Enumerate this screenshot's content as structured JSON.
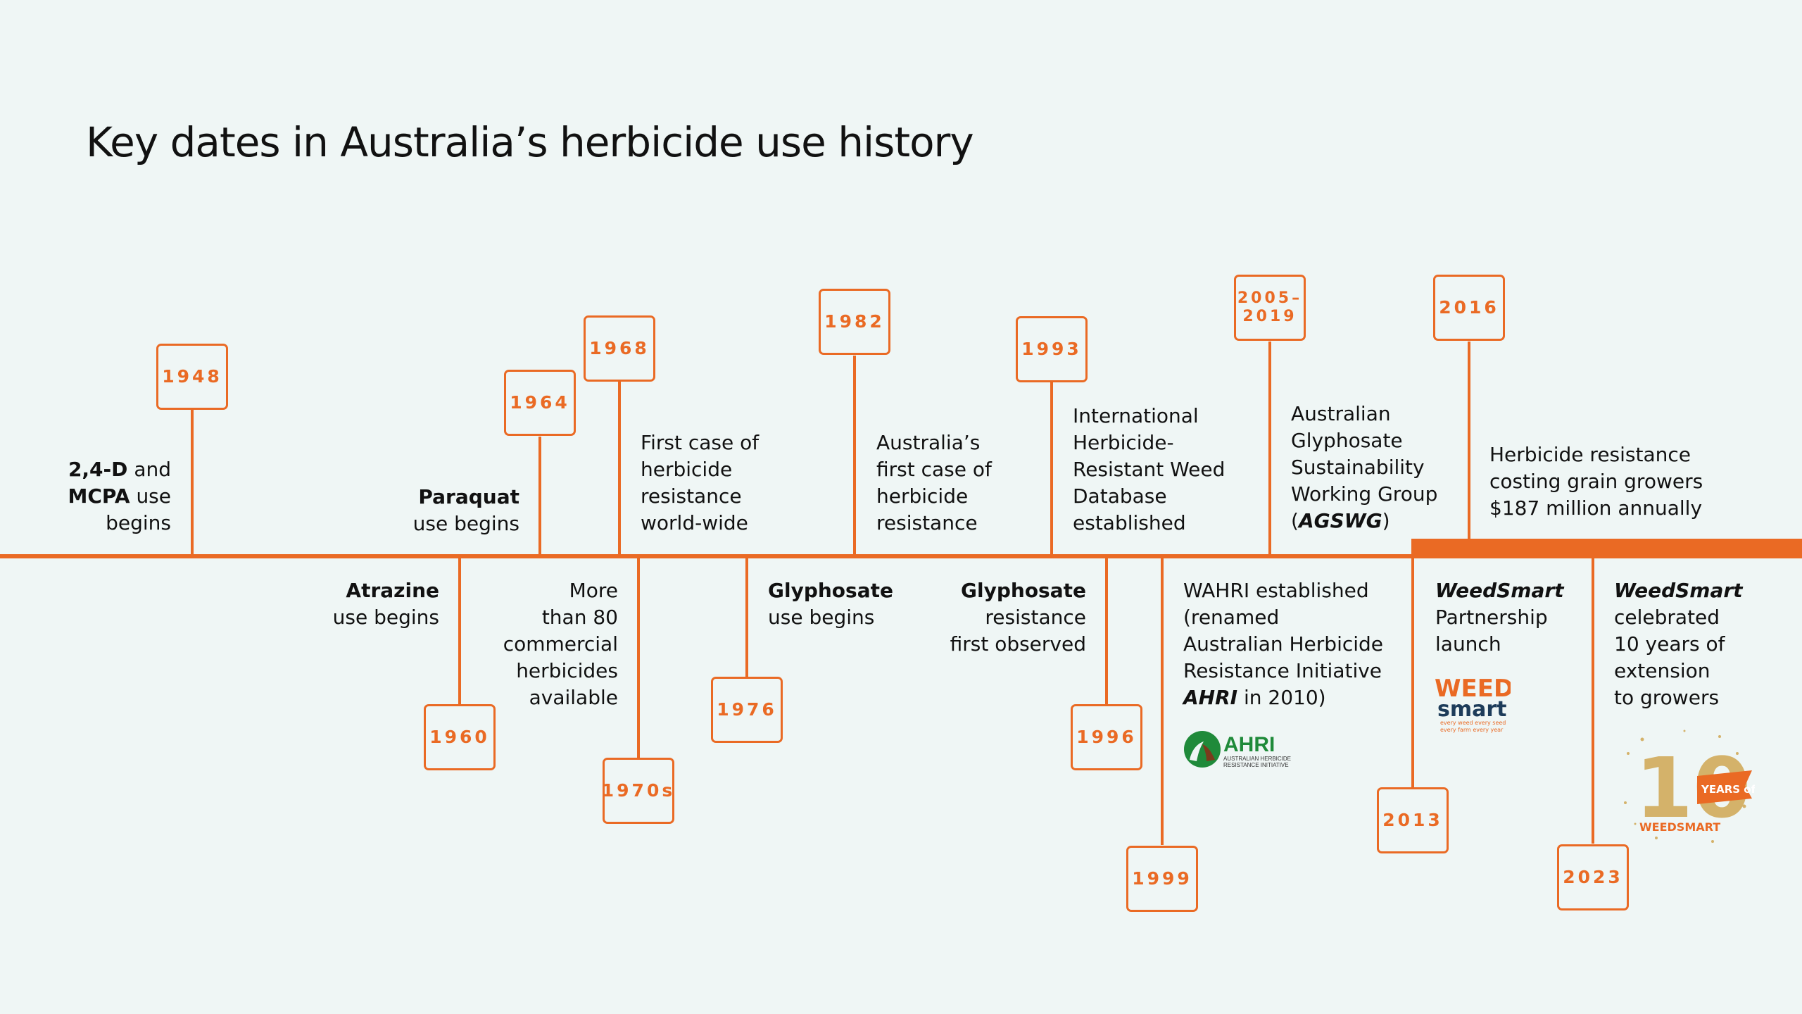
{
  "title": "Key dates in Australia’s herbicide use history",
  "colors": {
    "accent": "#ea6a24",
    "background": "#eff6f5",
    "text": "#111111",
    "ahri_green": "#1f8a3a",
    "weedsmart_navy": "#1d3c5a",
    "gold": "#d4b26a"
  },
  "events": [
    {
      "id": "1948",
      "year": "1948",
      "label": {
        "bold": "2,4-D",
        "text": "and",
        "bold2": "MCPA",
        "text2": "use",
        "line3": "begins"
      }
    },
    {
      "id": "1960",
      "year": "1960",
      "label": {
        "bold": "Atrazine",
        "text": "use begins"
      }
    },
    {
      "id": "1964",
      "year": "1964",
      "label": {
        "bold": "Paraquat",
        "text": "use begins"
      }
    },
    {
      "id": "1968",
      "year": "1968",
      "label": {
        "lines": [
          "First case of",
          "herbicide",
          "resistance",
          "world-wide"
        ]
      }
    },
    {
      "id": "1970s",
      "year": "1970s",
      "label": {
        "lines": [
          "More",
          "than 80",
          "commercial",
          "herbicides",
          "available"
        ]
      }
    },
    {
      "id": "1976",
      "year": "1976",
      "label": {
        "bold": "Glyphosate",
        "text": "use begins"
      }
    },
    {
      "id": "1982",
      "year": "1982",
      "label": {
        "lines": [
          "Australia’s",
          "first case of",
          "herbicide",
          "resistance"
        ]
      }
    },
    {
      "id": "1993",
      "year": "1993",
      "label": {
        "lines": [
          "International",
          "Herbicide-",
          "Resistant Weed",
          "Database",
          "established"
        ]
      }
    },
    {
      "id": "1996",
      "year": "1996",
      "label": {
        "bold": "Glyphosate",
        "lines": [
          "resistance",
          "first observed"
        ]
      }
    },
    {
      "id": "1999",
      "year": "1999",
      "label": {
        "lines": [
          "WAHRI established",
          "(renamed",
          "Australian Herbicide",
          "Resistance Initiative"
        ],
        "bold_italic": "AHRI",
        "tail": " in 2010)"
      },
      "logo": {
        "icon": "ahri-logo",
        "name": "AHRI",
        "sub1": "AUSTRALIAN HERBICIDE",
        "sub2": "RESISTANCE INITIATIVE"
      }
    },
    {
      "id": "2005-2019",
      "year_line1": "2005–",
      "year_line2": "2019",
      "label": {
        "lines": [
          "Australian",
          "Glyphosate",
          "Sustainability",
          "Working Group"
        ],
        "open": "(",
        "bold_italic": "AGSWG",
        "close": ")"
      }
    },
    {
      "id": "2013",
      "year": "2013",
      "label": {
        "bold_italic": "WeedSmart",
        "lines": [
          "Partnership",
          "launch"
        ]
      },
      "logo": {
        "icon": "weedsmart-logo",
        "word1": "WEED",
        "word2": "smart",
        "tag1": "every weed every seed",
        "tag2": "every farm every year"
      }
    },
    {
      "id": "2016",
      "year": "2016",
      "label": {
        "lines": [
          "Herbicide resistance",
          "costing grain growers",
          "$187 million annually"
        ]
      }
    },
    {
      "id": "2023",
      "year": "2023",
      "label": {
        "bold_italic": "WeedSmart",
        "lines": [
          "celebrated",
          "10 years of",
          "extension",
          "to growers"
        ]
      },
      "logo": {
        "icon": "ten-years-badge-icon",
        "number": "10",
        "ribbon": "YEARS of",
        "brand": "WEEDSMART"
      }
    }
  ]
}
